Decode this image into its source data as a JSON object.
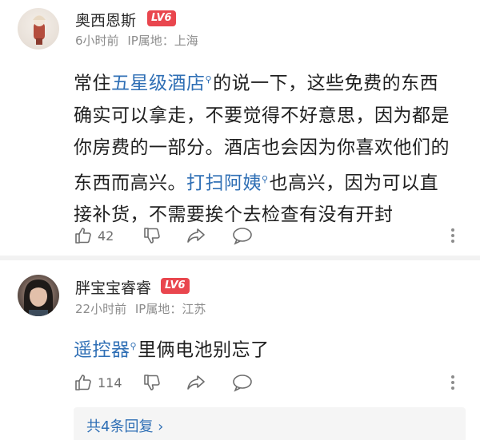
{
  "comments": [
    {
      "username": "奥西恩斯",
      "level": "LV6",
      "time": "6小时前",
      "ip": "IP属地：上海",
      "lines": [
        [
          {
            "t": "常住"
          },
          {
            "t": "五星级酒店",
            "link": true
          },
          {
            "t": "的说一下，这些免费的东西"
          }
        ],
        [
          {
            "t": "确实可以拿走，不要觉得不好意思，因为都是"
          }
        ],
        [
          {
            "t": "你房费的一部分。酒店也会因为你喜欢他们的"
          }
        ],
        [
          {
            "t": "东西而高兴。"
          },
          {
            "t": "打扫阿姨",
            "link": true
          },
          {
            "t": "也高兴，因为可以直"
          }
        ],
        [
          {
            "t": "接补货，不需要挨个去检查有没有开封"
          }
        ]
      ],
      "likes": "42"
    },
    {
      "username": "胖宝宝睿睿",
      "level": "LV6",
      "time": "22小时前",
      "ip": "IP属地：江苏",
      "lines": [
        [
          {
            "t": "遥控器",
            "link": true
          },
          {
            "t": "里俩电池别忘了"
          }
        ]
      ],
      "likes": "114",
      "replies_label": "共4条回复 ›"
    }
  ],
  "icons": {
    "like": "thumbs-up-icon",
    "dislike": "thumbs-down-icon",
    "share": "share-icon",
    "reply": "comment-icon",
    "more": "more-vertical-icon",
    "search_hint": "search-icon"
  },
  "colors": {
    "link": "#2f6fb5",
    "level_badge": "#e9464e",
    "meta": "#8c8c8c",
    "icon": "#6d6d6d"
  }
}
